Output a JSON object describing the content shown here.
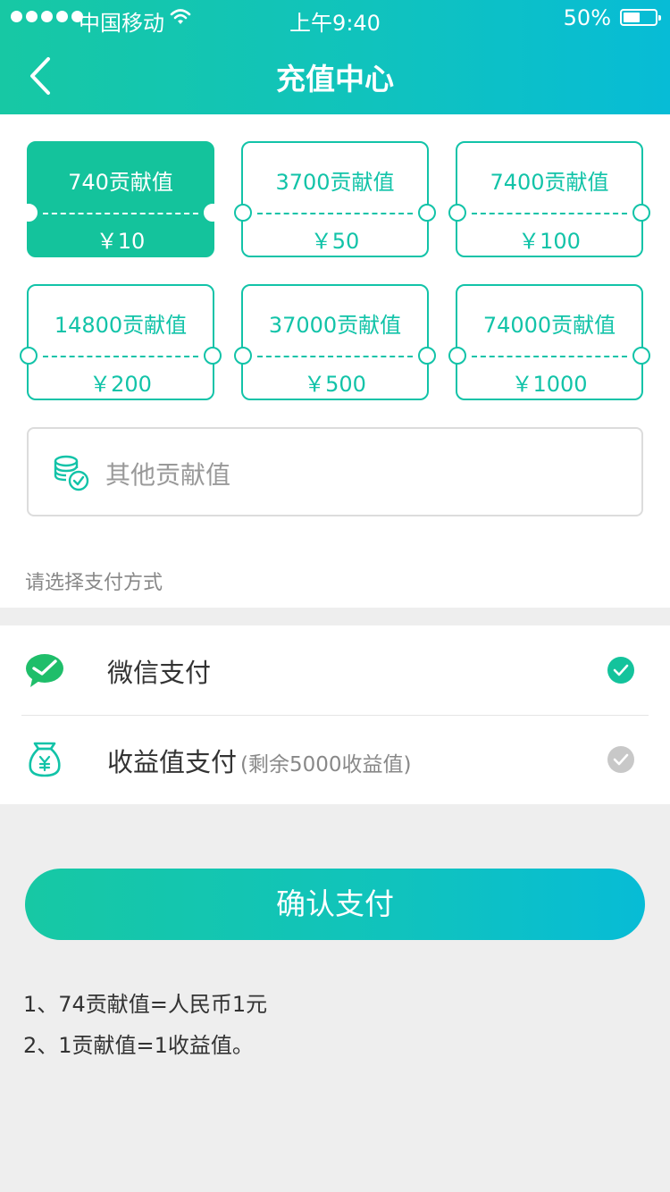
{
  "status_bar": {
    "carrier": "中国移动",
    "time": "上午9:40",
    "battery": "50%"
  },
  "header": {
    "title": "充值中心"
  },
  "packages": [
    {
      "points": "740贡献值",
      "price": "￥10",
      "selected": true
    },
    {
      "points": "3700贡献值",
      "price": "￥50",
      "selected": false
    },
    {
      "points": "7400贡献值",
      "price": "￥100",
      "selected": false
    },
    {
      "points": "14800贡献值",
      "price": "￥200",
      "selected": false
    },
    {
      "points": "37000贡献值",
      "price": "￥500",
      "selected": false
    },
    {
      "points": "74000贡献值",
      "price": "￥1000",
      "selected": false
    }
  ],
  "other_input": {
    "placeholder": "其他贡献值"
  },
  "payment": {
    "hint": "请选择支付方式",
    "methods": [
      {
        "label": "微信支付",
        "sub": "",
        "checked": true,
        "icon": "wechat-icon"
      },
      {
        "label": "收益值支付",
        "sub": "(剩余5000收益值)",
        "checked": true,
        "icon": "money-bag-icon"
      }
    ]
  },
  "confirm_label": "确认支付",
  "notes": [
    "1、74贡献值=人民币1元",
    "2、1贡献值=1收益值。"
  ],
  "colors": {
    "accent": "#14c39c",
    "gradient_end": "#07bcd6",
    "disabled": "#c8c8c8"
  }
}
